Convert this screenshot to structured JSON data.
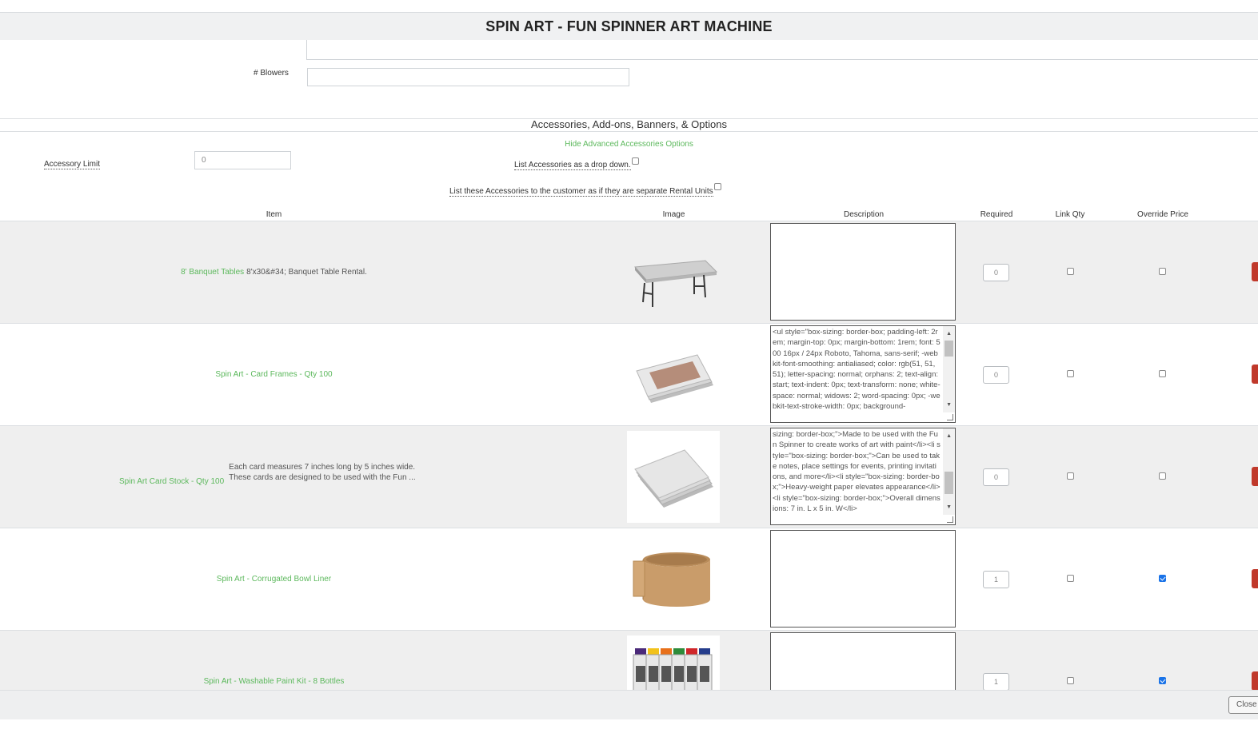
{
  "modal": {
    "title": "SPIN ART - FUN SPINNER ART MACHINE",
    "blowers_label": "# Blowers",
    "blowers_value": ""
  },
  "accessories": {
    "section_title": "Accessories, Add-ons, Banners, & Options",
    "hide_advanced_link": "Hide Advanced Accessories Options",
    "accessory_limit_label": "Accessory Limit",
    "accessory_limit_value": "0",
    "list_dropdown_label": "List Accessories as a drop down.",
    "list_dropdown_checked": false,
    "separate_units_label": "List these Accessories to the customer as if they are separate Rental Units",
    "separate_units_checked": false
  },
  "table": {
    "headers": {
      "item": "Item",
      "image": "Image",
      "description": "Description",
      "required": "Required",
      "link_qty": "Link Qty",
      "override_price": "Override Price"
    },
    "rows": [
      {
        "name": "8' Banquet Tables",
        "short_desc": "8'x30&#34; Banquet Table Rental.",
        "image": "banquet-table-image",
        "description": "",
        "required": "0",
        "link_qty": false,
        "override_price": false
      },
      {
        "name": "Spin Art - Card Frames - Qty 100",
        "short_desc": "",
        "image": "card-frames-image",
        "description": "<ul style=\"box-sizing: border-box; padding-left: 2rem; margin-top: 0px; margin-bottom: 1rem; font: 500 16px / 24px Roboto, Tahoma, sans-serif; -webkit-font-smoothing: antialiased; color: rgb(51, 51, 51); letter-spacing: normal; orphans: 2; text-align: start; text-indent: 0px; text-transform: none; white-space: normal; widows: 2; word-spacing: 0px; -webkit-text-stroke-width: 0px; background-",
        "required": "0",
        "link_qty": false,
        "override_price": false
      },
      {
        "name": "Spin Art Card Stock - Qty 100",
        "short_desc_line1": "Each card measures 7 inches long by 5 inches wide.",
        "short_desc_line2": "These cards are designed to be used with the Fun ...",
        "image": "card-stock-image",
        "description": "sizing: border-box;\">Made to be used with the Fun Spinner to create works of art with paint</li><li style=\"box-sizing: border-box;\">Can be used to take notes, place settings for events, printing invitations, and more</li><li style=\"box-sizing: border-box;\">Heavy-weight paper elevates appearance</li><li style=\"box-sizing: border-box;\">Overall dimensions: 7 in. L x 5 in. W</li>",
        "required": "0",
        "link_qty": false,
        "override_price": false
      },
      {
        "name": "Spin Art - Corrugated Bowl Liner",
        "short_desc": "",
        "image": "bowl-liner-image",
        "description": "",
        "required": "1",
        "link_qty": false,
        "override_price": true
      },
      {
        "name": "Spin Art - Washable Paint Kit - 8 Bottles",
        "short_desc": "",
        "image": "paint-kit-image",
        "description": "",
        "required": "1",
        "link_qty": false,
        "override_price": true
      }
    ]
  },
  "footer": {
    "close_label": "Close"
  },
  "colors": {
    "link_green": "#5cb85c",
    "checkbox_blue": "#1a73e8",
    "delete_red": "#c0392b",
    "header_gray": "#f0f1f2"
  }
}
